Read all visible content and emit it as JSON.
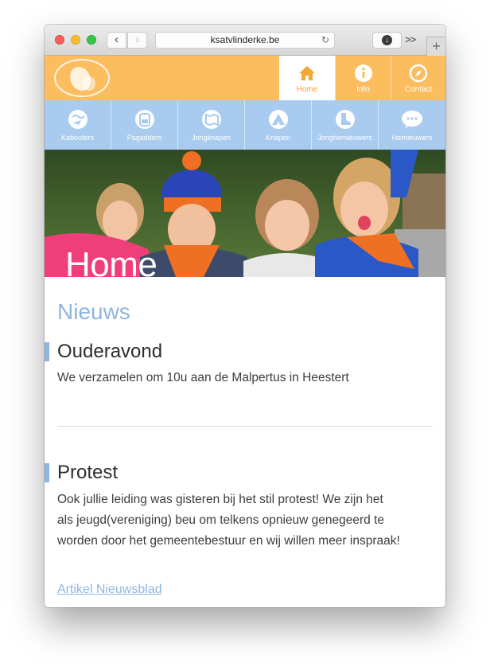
{
  "browser": {
    "url": "ksatvlinderke.be",
    "back_glyph": "‹",
    "forward_glyph": "›",
    "more_glyph": ">>",
    "newtab_glyph": "+"
  },
  "topnav": [
    {
      "label": "Home",
      "icon": "house-icon",
      "active": true
    },
    {
      "label": "Info",
      "icon": "info-icon",
      "active": false
    },
    {
      "label": "Contact",
      "icon": "compass-icon",
      "active": false
    }
  ],
  "groups": [
    {
      "label": "Kabouters",
      "icon": "globe-plane-icon"
    },
    {
      "label": "Pagadders",
      "icon": "backpack-icon"
    },
    {
      "label": "Jongknapen",
      "icon": "map-icon"
    },
    {
      "label": "Knapen",
      "icon": "tent-icon"
    },
    {
      "label": "Jonghernieuwers",
      "icon": "boot-icon"
    },
    {
      "label": "Hernieuwers",
      "icon": "speech-icon"
    }
  ],
  "hero": {
    "title": "Home"
  },
  "news": {
    "heading": "Nieuws",
    "posts": [
      {
        "title": "Ouderavond",
        "body": "We verzamelen om 10u aan de Malpertus in Heestert"
      },
      {
        "title": "Protest",
        "body": "Ook jullie leiding was gisteren bij het stil protest! We zijn het als jeugd(vereniging) beu om telkens opnieuw genegeerd te worden door het gemeentebestuur en wij willen meer inspraak!",
        "link": "Artikel Nieuwsblad"
      }
    ]
  },
  "colors": {
    "orange_bar": "#fbbd5d",
    "blue_bar": "#a9cbef",
    "accent_blue": "#8fb6e2"
  }
}
